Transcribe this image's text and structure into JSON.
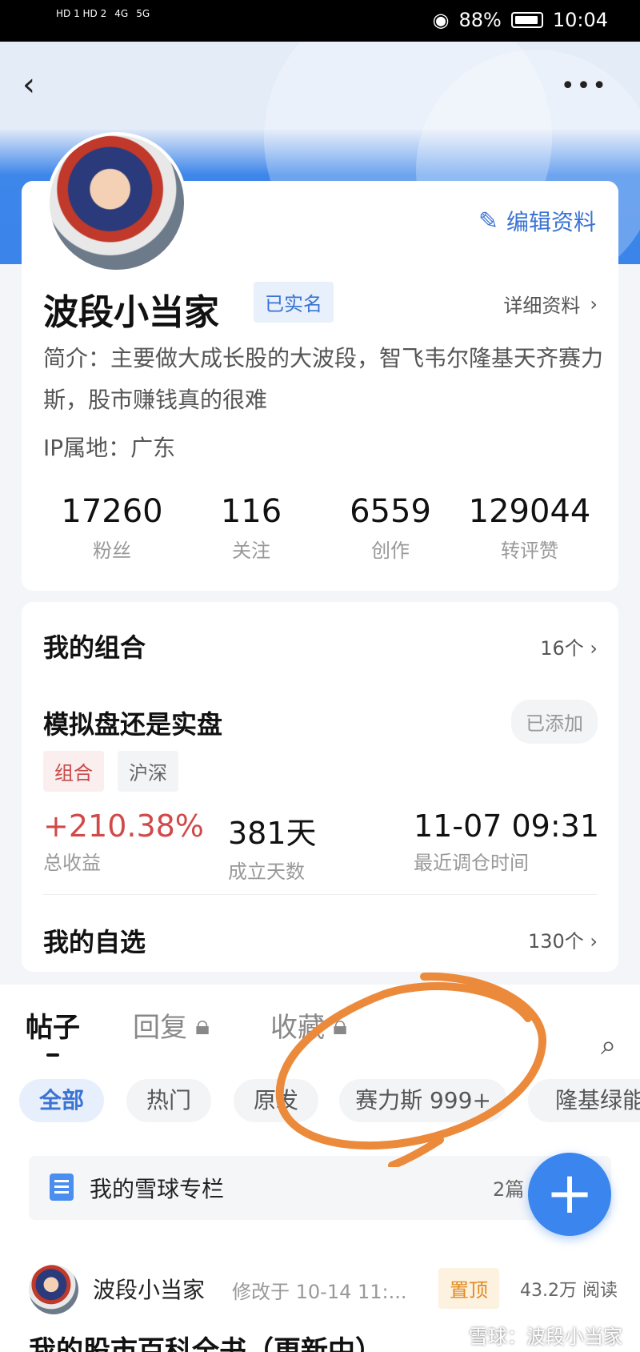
{
  "status_bar": {
    "left": [
      "HD 1 HD 2",
      "4G",
      "5G"
    ],
    "battery": "88%",
    "time": "10:04"
  },
  "header": {
    "back_icon": "chevron-left-icon",
    "more_icon": "ellipsis-icon"
  },
  "profile": {
    "edit_label": "编辑资料",
    "username": "波段小当家",
    "verified_label": "已实名",
    "detail_link": "详细资料",
    "bio": "简介：主要做大成长股的大波段，智飞韦尔隆基天齐赛力斯，股市赚钱真的很难",
    "ip": "IP属地：广东",
    "stats": [
      {
        "value": "17260",
        "label": "粉丝"
      },
      {
        "value": "116",
        "label": "关注"
      },
      {
        "value": "6559",
        "label": "创作"
      },
      {
        "value": "129044",
        "label": "转评赞"
      }
    ]
  },
  "portfolio": {
    "title": "我的组合",
    "count": "16个",
    "name": "模拟盘还是实盘",
    "added_label": "已添加",
    "tags": [
      "组合",
      "沪深"
    ],
    "return_value": "+210.38%",
    "return_label": "总收益",
    "days_value": "381天",
    "days_label": "成立天数",
    "rebalance_value": "11-07 09:31",
    "rebalance_label": "最近调仓时间"
  },
  "watchlist": {
    "title": "我的自选",
    "count": "130个"
  },
  "tabs": [
    {
      "label": "帖子",
      "active": true,
      "locked": false
    },
    {
      "label": "回复",
      "active": false,
      "locked": true
    },
    {
      "label": "收藏",
      "active": false,
      "locked": true
    }
  ],
  "chips": [
    "全部",
    "热门",
    "原发",
    "赛力斯 999+",
    "隆基绿能"
  ],
  "column": {
    "label": "我的雪球专栏",
    "count": "2篇"
  },
  "post": {
    "author": "波段小当家",
    "time": "修改于 10-14 11:...",
    "pin_label": "置顶",
    "reads": "43.2万 阅读",
    "title": "我的股市百科全书（更新中）"
  },
  "watermark": "雪球：波段小当家",
  "colors": {
    "accent": "#3a73d4",
    "fab": "#3a85ee",
    "return_red": "#d04a4a",
    "annotation": "#ec8a3c"
  }
}
